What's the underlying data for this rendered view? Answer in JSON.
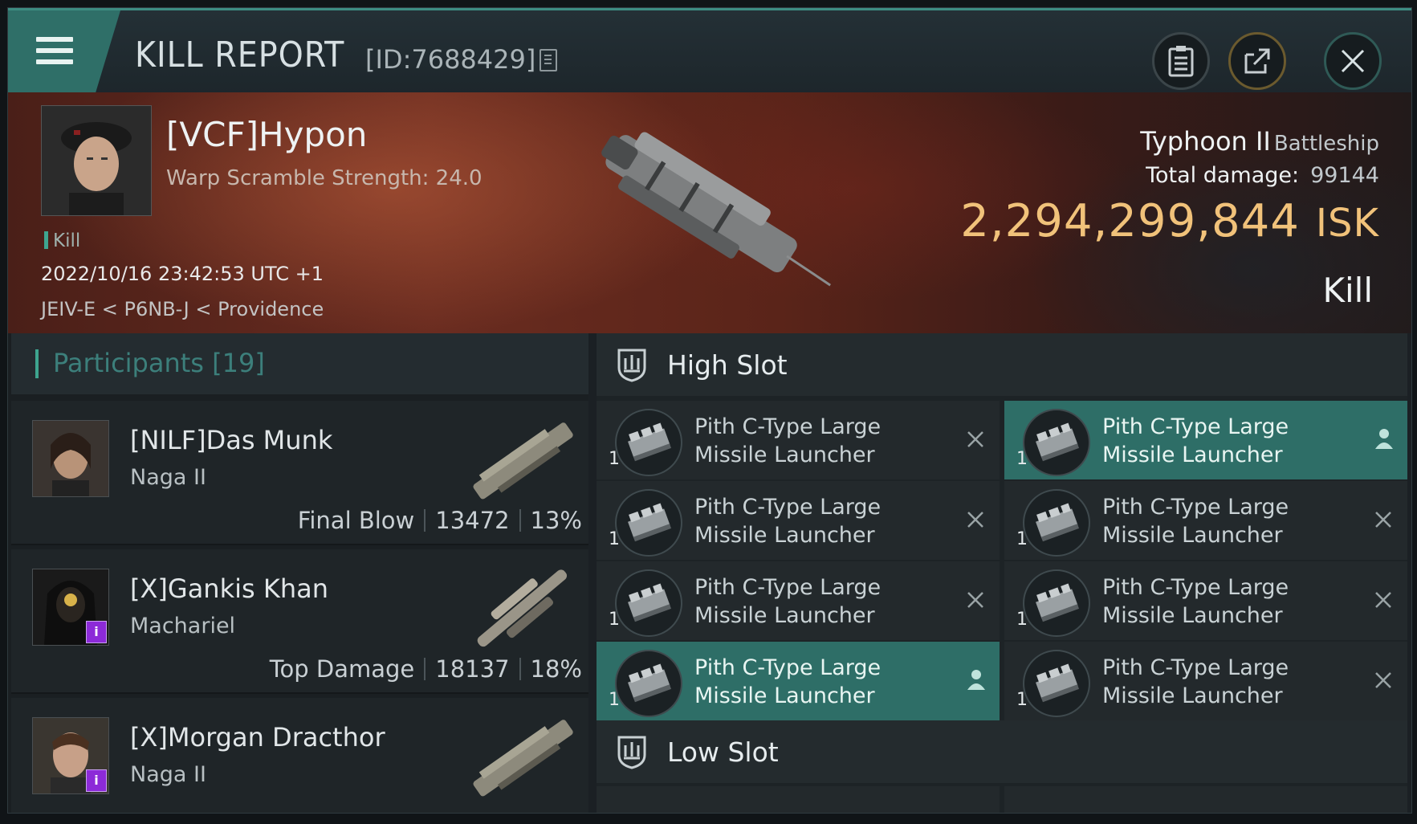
{
  "window": {
    "title": "KILL REPORT",
    "report_id": "[ID:7688429]"
  },
  "victim": {
    "name": "[VCF]Hypon",
    "warp_scramble": "Warp Scramble Strength: 24.0",
    "tag": "Kill",
    "datetime": "2022/10/16 23:42:53 UTC +1",
    "location": "JEIV-E < P6NB-J < Providence",
    "ship_name": "Typhoon II",
    "ship_class": "Battleship",
    "total_damage_label": "Total damage:",
    "total_damage": "99144",
    "isk_value": "2,294,299,844",
    "isk_unit": "ISK",
    "result": "Kill"
  },
  "participants": {
    "header": "Participants [19]",
    "items": [
      {
        "name": "[NILF]Das Munk",
        "ship": "Naga II",
        "role": "Final Blow",
        "damage": "13472",
        "percent": "13%"
      },
      {
        "name": "[X]Gankis Khan",
        "ship": "Machariel",
        "role": "Top Damage",
        "damage": "18137",
        "percent": "18%",
        "badge": "i"
      },
      {
        "name": "[X]Morgan Dracthor",
        "ship": "Naga II",
        "badge": "i"
      }
    ]
  },
  "fittings": {
    "high_slot_label": "High Slot",
    "low_slot_label": "Low Slot",
    "high_slot": [
      {
        "line1": "Pith C-Type Large",
        "line2": "Missile Launcher",
        "qty": "1",
        "state": "destroyed"
      },
      {
        "line1": "Pith C-Type Large",
        "line2": "Missile Launcher",
        "qty": "1",
        "state": "dropped"
      },
      {
        "line1": "Pith C-Type Large",
        "line2": "Missile Launcher",
        "qty": "1",
        "state": "destroyed"
      },
      {
        "line1": "Pith C-Type Large",
        "line2": "Missile Launcher",
        "qty": "1",
        "state": "destroyed"
      },
      {
        "line1": "Pith C-Type Large",
        "line2": "Missile Launcher",
        "qty": "1",
        "state": "destroyed"
      },
      {
        "line1": "Pith C-Type Large",
        "line2": "Missile Launcher",
        "qty": "1",
        "state": "destroyed"
      },
      {
        "line1": "Pith C-Type Large",
        "line2": "Missile Launcher",
        "qty": "1",
        "state": "dropped"
      },
      {
        "line1": "Pith C-Type Large",
        "line2": "Missile Launcher",
        "qty": "1",
        "state": "destroyed"
      }
    ]
  },
  "colors": {
    "accent_teal": "#2e6e67",
    "isk_gold": "#f1c27a",
    "badge_purple": "#8c2ad8"
  }
}
